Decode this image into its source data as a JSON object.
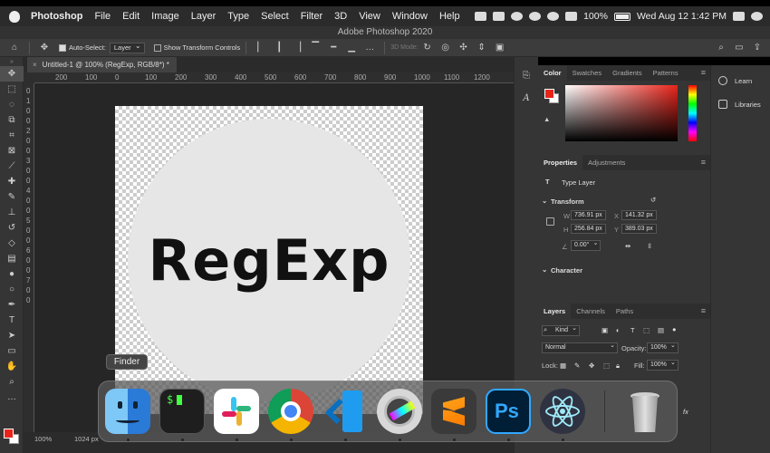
{
  "menubar": {
    "items": [
      "Photoshop",
      "File",
      "Edit",
      "Image",
      "Layer",
      "Type",
      "Select",
      "Filter",
      "3D",
      "View",
      "Window",
      "Help"
    ],
    "battery": "100%",
    "datetime": "Wed Aug 12  1:42 PM"
  },
  "window": {
    "title": "Adobe Photoshop 2020"
  },
  "options": {
    "auto_select_label": "Auto-Select:",
    "auto_select_value": "Layer",
    "show_transform_label": "Show Transform Controls",
    "mode_3d_label": "3D Mode:"
  },
  "document": {
    "tab_title": "Untitled-1 @ 100% (RegExp, RGB/8*) *",
    "canvas_text": "RegExp",
    "zoom": "100%",
    "status_size": "1024 px"
  },
  "rulers": {
    "h_labels": [
      "200",
      "100",
      "0",
      "100",
      "200",
      "300",
      "400",
      "500",
      "600",
      "700",
      "800",
      "900",
      "1000",
      "1100",
      "1200"
    ],
    "v_labels": [
      "0",
      "1",
      "0",
      "0",
      "2",
      "0",
      "0",
      "3",
      "0",
      "0",
      "4",
      "0",
      "0",
      "5",
      "0",
      "0",
      "6",
      "0",
      "0",
      "7",
      "0",
      "0"
    ]
  },
  "color_panel": {
    "tabs": [
      "Color",
      "Swatches",
      "Gradients",
      "Patterns"
    ],
    "fg_color": "#e8241a"
  },
  "properties_panel": {
    "tabs": [
      "Properties",
      "Adjustments"
    ],
    "layer_type": "Type Layer",
    "transform_title": "Transform",
    "w_label": "W",
    "w_value": "736.91 px",
    "x_label": "X",
    "x_value": "141.32 px",
    "h_label": "H",
    "h_value": "256.84 px",
    "y_label": "Y",
    "y_value": "389.03 px",
    "angle_value": "0.00°",
    "character_title": "Character"
  },
  "layers_panel": {
    "tabs": [
      "Layers",
      "Channels",
      "Paths"
    ],
    "filter_kind": "Kind",
    "blend_mode": "Normal",
    "opacity_label": "Opacity:",
    "opacity_value": "100%",
    "lock_label": "Lock:",
    "fill_label": "Fill:",
    "fill_value": "100%"
  },
  "right_dock": {
    "items": [
      "Learn",
      "Libraries"
    ]
  },
  "dock": {
    "tooltip": "Finder",
    "apps": [
      "finder",
      "terminal",
      "slack",
      "chrome",
      "vscode",
      "final-cut",
      "sublime-text",
      "photoshop",
      "electron",
      "trash"
    ],
    "terminal_prompt": "$",
    "photoshop_label": "Ps"
  }
}
